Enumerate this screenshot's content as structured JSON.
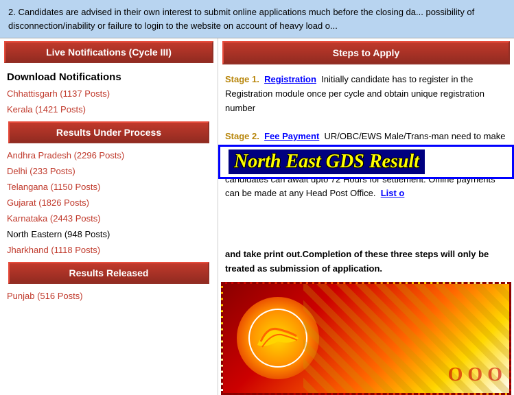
{
  "banner": {
    "text": "2. Candidates are advised in their own interest to submit online applications much before the closing da... possibility of disconnection/inability or failure to login to the website on account of heavy load o..."
  },
  "sidebar": {
    "live_notifications_header": "Live Notifications (Cycle III)",
    "download_notifications_title": "Download Notifications",
    "download_links": [
      {
        "label": "Chhattisgarh (1137 Posts)"
      },
      {
        "label": "Kerala (1421 Posts)"
      }
    ],
    "results_under_process_header": "Results Under Process",
    "under_process_links": [
      {
        "label": "Andhra Pradesh (2296 Posts)"
      },
      {
        "label": "Delhi (233 Posts)"
      },
      {
        "label": "Telangana (1150 Posts)"
      },
      {
        "label": "Gujarat (1826 Posts)"
      },
      {
        "label": "Karnataka (2443 Posts)"
      },
      {
        "label": "North Eastern (948 Posts)"
      },
      {
        "label": "Jharkhand (1118 Posts)"
      }
    ],
    "results_released_header": "Results Released",
    "released_links": [
      {
        "label": "Punjab (516 Posts)"
      }
    ]
  },
  "right_panel": {
    "steps_header": "Steps to Apply",
    "stage1_label": "Stage 1.",
    "stage1_link": "Registration",
    "stage1_text": "Initially candidate has to register in the Registration module once per cycle and obtain unique registration number",
    "stage2_label": "Stage 2.",
    "stage2_link": "Fee Payment",
    "stage2_text": "UR/OBC/EWS Male/Trans-man need to make fee payment. In Case of online payment, if no confirmation received after the deduction of amount from candidate's bank account, candidates can await upto 72 Hours for settlement. Offline payments can be made at any Head Post Office.",
    "list_link": "List o",
    "overlay_text": "North East GDS Result",
    "continued_text": "and take print out.Completion of these three steps will only be treated as submission of application."
  }
}
